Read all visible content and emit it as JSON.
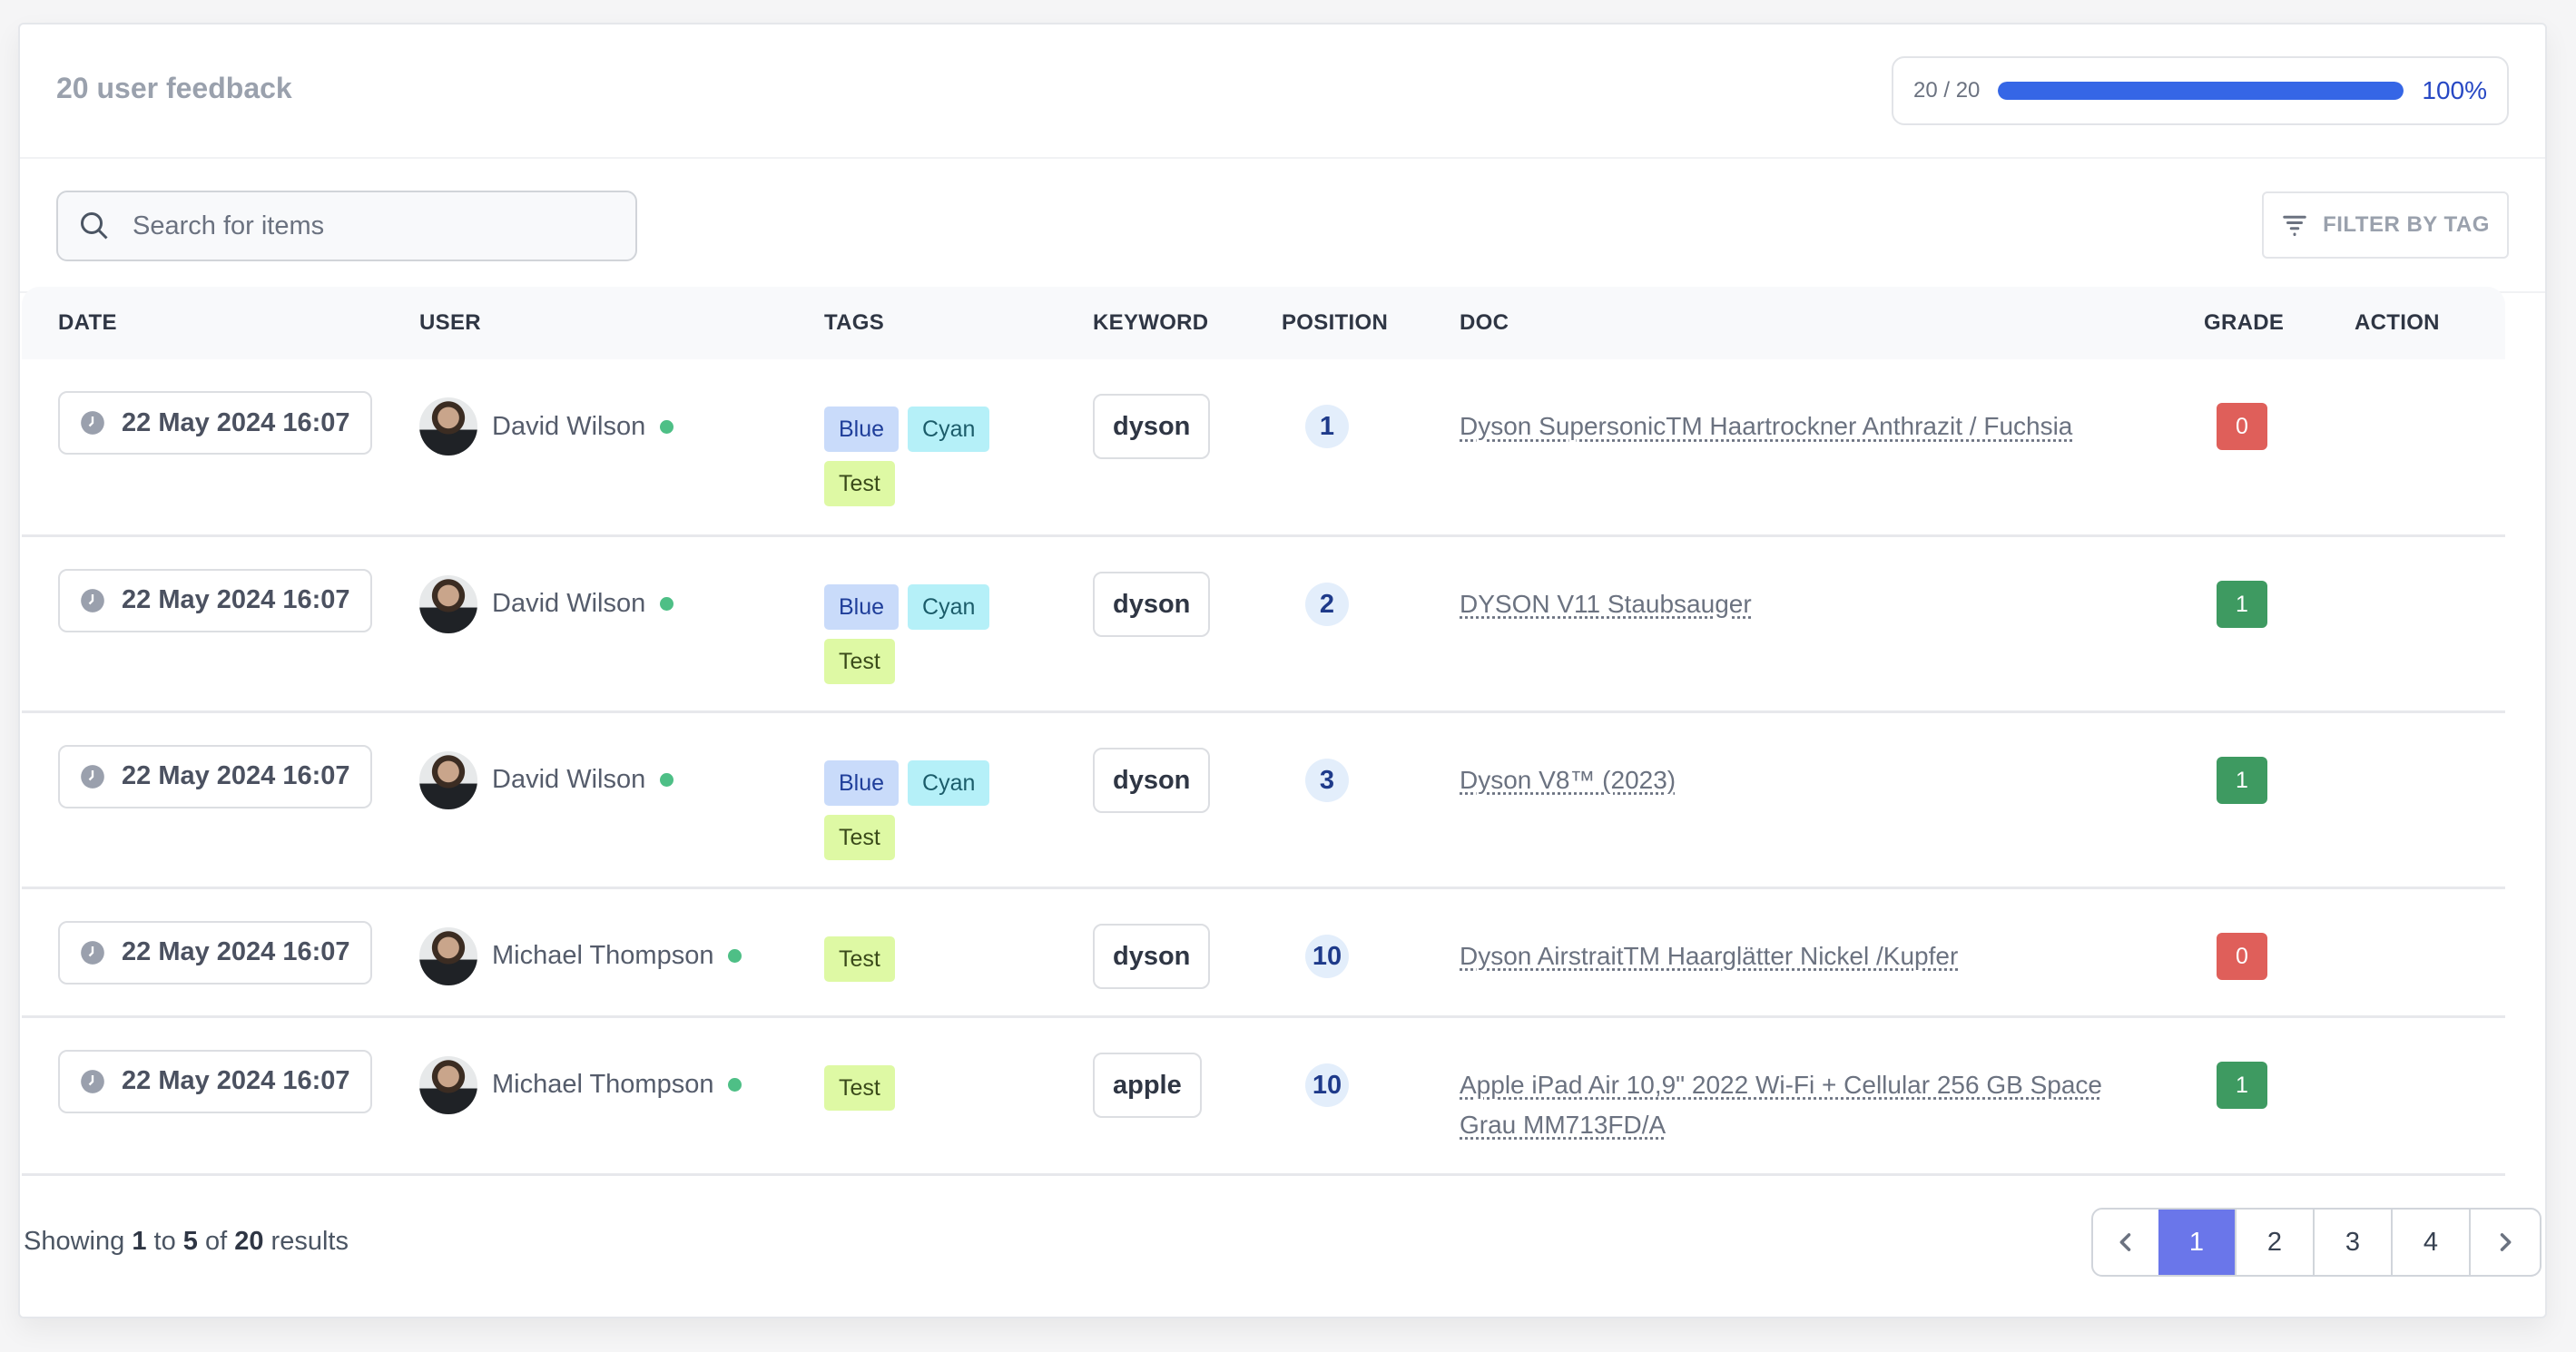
{
  "header": {
    "title": "20 user feedback",
    "progress": {
      "count": "20 / 20",
      "fraction": 1.0,
      "percent_label": "100%",
      "color": "#3566e6"
    }
  },
  "toolbar": {
    "search_placeholder": "Search for items",
    "filter_label": "FILTER BY TAG"
  },
  "table": {
    "columns": [
      "DATE",
      "USER",
      "TAGS",
      "KEYWORD",
      "POSITION",
      "DOC",
      "GRADE",
      "ACTION"
    ],
    "rows": [
      {
        "date": "22 May 2024 16:07",
        "user": "David Wilson",
        "tags": [
          "Blue",
          "Cyan",
          "Test"
        ],
        "keyword": "dyson",
        "position": "1",
        "doc": "Dyson SupersonicTM Haartrockner Anthrazit / Fuchsia",
        "grade": "0",
        "grade_color": "#df5f5a"
      },
      {
        "date": "22 May 2024 16:07",
        "user": "David Wilson",
        "tags": [
          "Blue",
          "Cyan",
          "Test"
        ],
        "keyword": "dyson",
        "position": "2",
        "doc": "DYSON V11 Staubsauger",
        "grade": "1",
        "grade_color": "#3e9a61"
      },
      {
        "date": "22 May 2024 16:07",
        "user": "David Wilson",
        "tags": [
          "Blue",
          "Cyan",
          "Test"
        ],
        "keyword": "dyson",
        "position": "3",
        "doc": "Dyson V8™ (2023)",
        "grade": "1",
        "grade_color": "#3e9a61"
      },
      {
        "date": "22 May 2024 16:07",
        "user": "Michael Thompson",
        "tags": [
          "Test"
        ],
        "keyword": "dyson",
        "position": "10",
        "doc": "Dyson AirstraitTM Haarglätter Nickel /Kupfer",
        "grade": "0",
        "grade_color": "#df5f5a"
      },
      {
        "date": "22 May 2024 16:07",
        "user": "Michael Thompson",
        "tags": [
          "Test"
        ],
        "keyword": "apple",
        "position": "10",
        "doc": "Apple iPad Air 10,9\" 2022 Wi-Fi + Cellular 256 GB Space Grau MM713FD/A",
        "grade": "1",
        "grade_color": "#3e9a61"
      }
    ]
  },
  "footer": {
    "showing_prefix": "Showing",
    "from": "1",
    "to_word": "to",
    "to": "5",
    "of_word": "of",
    "total": "20",
    "suffix": "results"
  },
  "pagination": {
    "prev_icon": "chevron-left-icon",
    "next_icon": "chevron-right-icon",
    "pages": [
      "1",
      "2",
      "3",
      "4"
    ],
    "active_page": "1",
    "active_color": "#6a76ea"
  }
}
